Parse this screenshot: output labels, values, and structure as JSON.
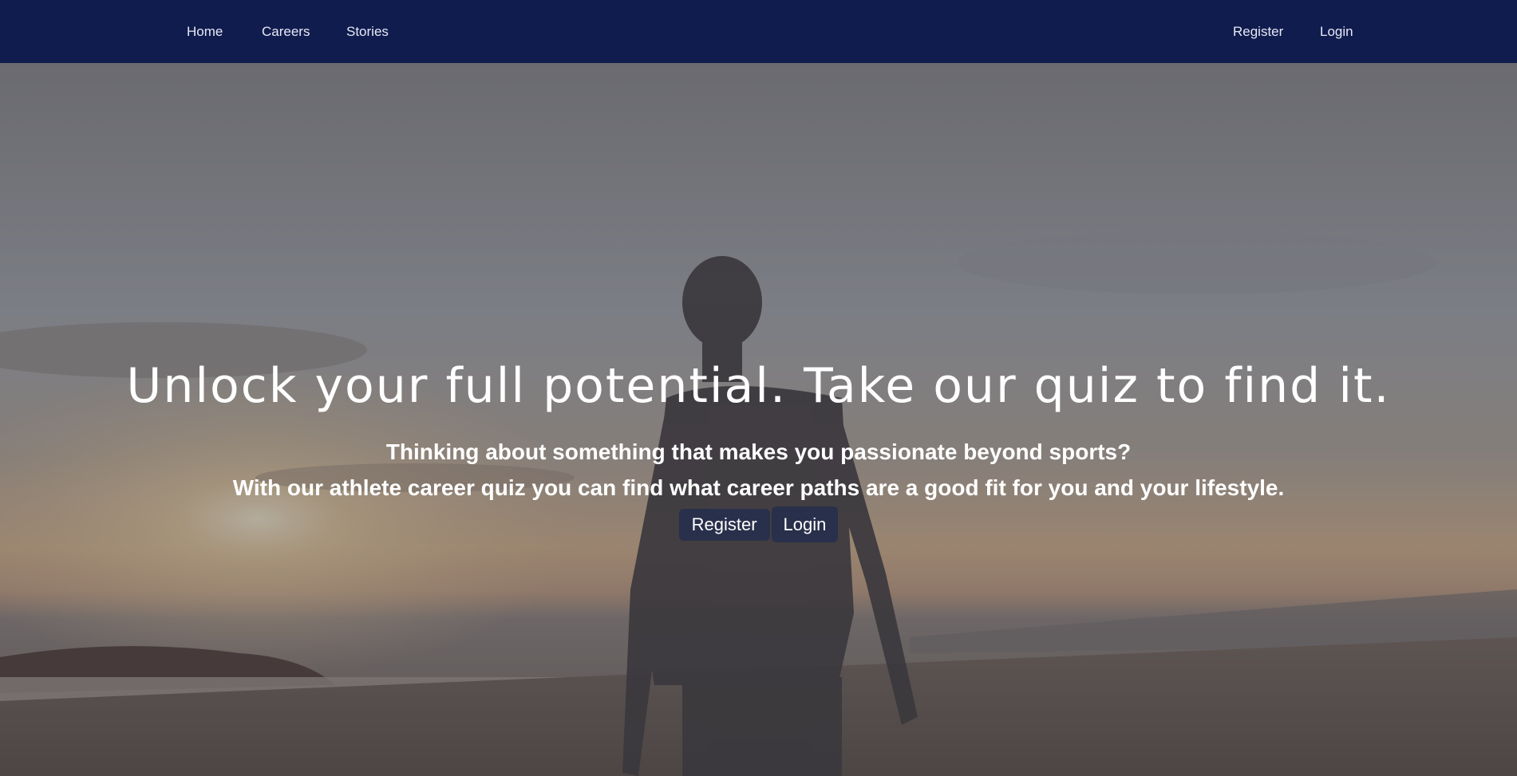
{
  "nav": {
    "left": [
      "Home",
      "Careers",
      "Stories"
    ],
    "right": [
      "Register",
      "Login"
    ]
  },
  "hero": {
    "title": "Unlock your full potential. Take our quiz to find it.",
    "subtitle_line1": "Thinking about something that makes you passionate beyond sports?",
    "subtitle_line2": "With our athlete career quiz you can find what career paths are a good fit for you and your lifestyle.",
    "register_label": "Register",
    "login_label": "Login"
  },
  "colors": {
    "navbar_bg": "#111c4e",
    "nav_text": "#e6e9f5",
    "button_bg": "#232d4e",
    "hero_text": "#ffffff"
  }
}
